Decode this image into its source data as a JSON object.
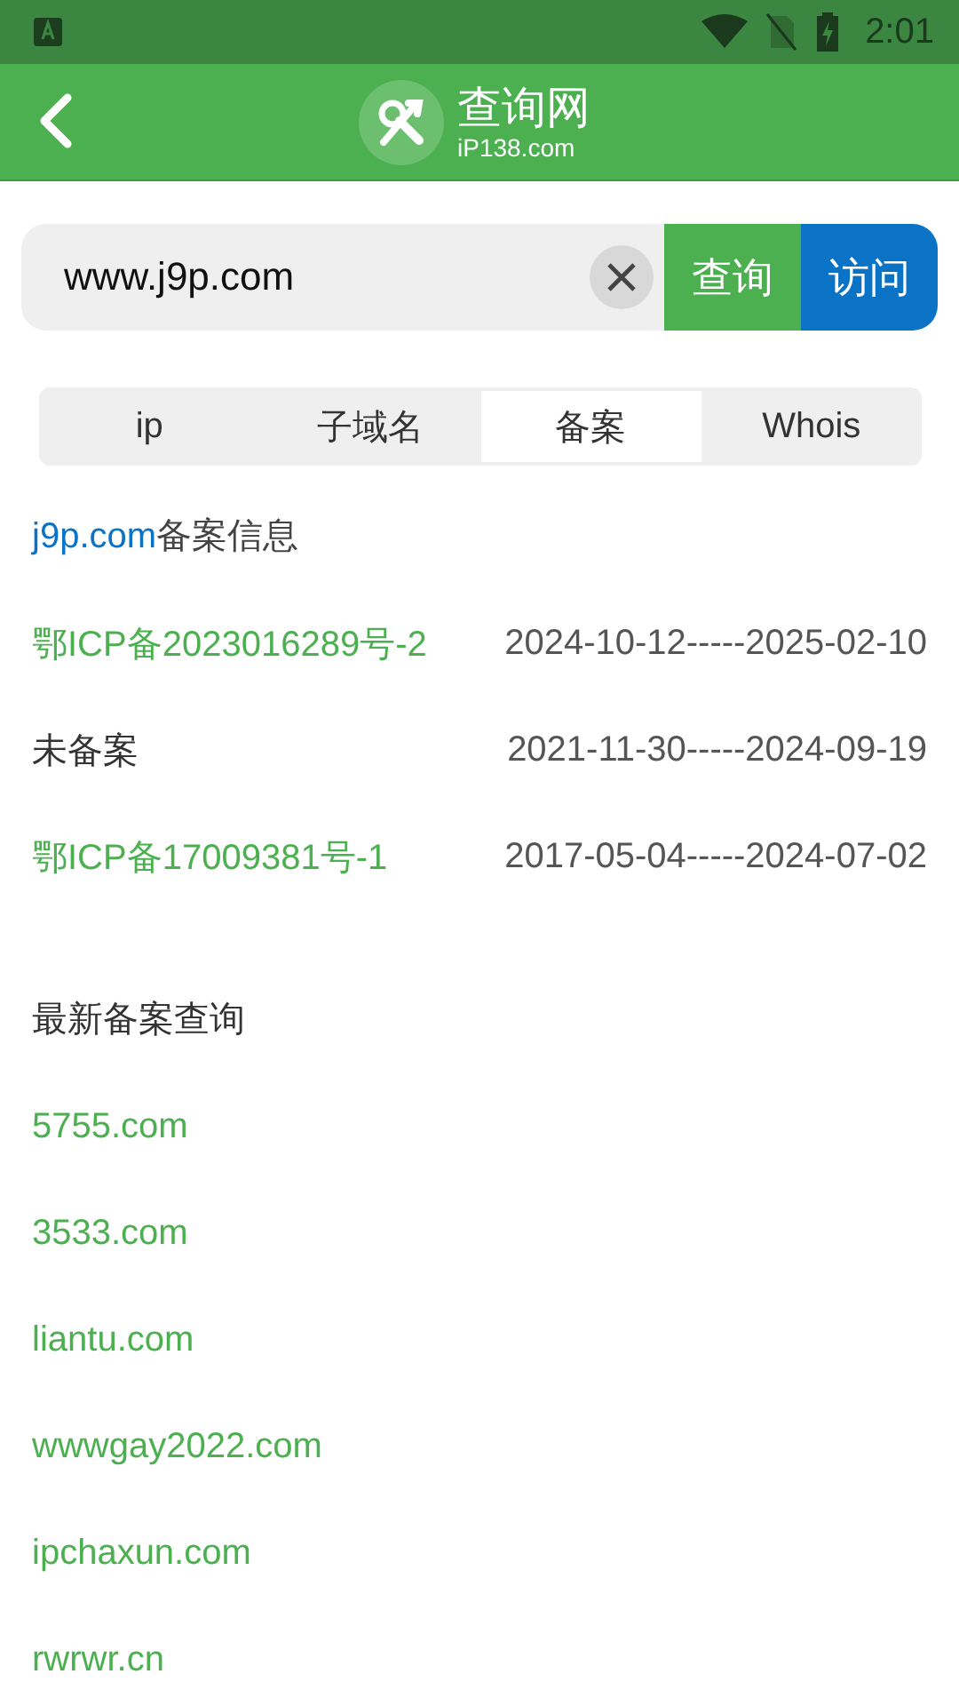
{
  "status_bar": {
    "time": "2:01"
  },
  "app_bar": {
    "logo_title": "查询网",
    "logo_subtitle": "iP138.com"
  },
  "search": {
    "value": "www.j9p.com",
    "query_button": "查询",
    "visit_button": "访问"
  },
  "tabs": [
    {
      "label": "ip",
      "selected": false
    },
    {
      "label": "子域名",
      "selected": false
    },
    {
      "label": "备案",
      "selected": true
    },
    {
      "label": "Whois",
      "selected": false
    }
  ],
  "record_heading": {
    "domain": "j9p.com",
    "suffix": "备案信息"
  },
  "records": [
    {
      "license": "鄂ICP备2023016289号-2",
      "registered": true,
      "period": "2024-10-12-----2025-02-10"
    },
    {
      "license": "未备案",
      "registered": false,
      "period": "2021-11-30-----2024-09-19"
    },
    {
      "license": "鄂ICP备17009381号-1",
      "registered": true,
      "period": "2017-05-04-----2024-07-02"
    }
  ],
  "latest_heading": "最新备案查询",
  "latest_links": [
    "5755.com",
    "3533.com",
    "liantu.com",
    "wwwgay2022.com",
    "ipchaxun.com",
    "rwrwr.cn"
  ]
}
